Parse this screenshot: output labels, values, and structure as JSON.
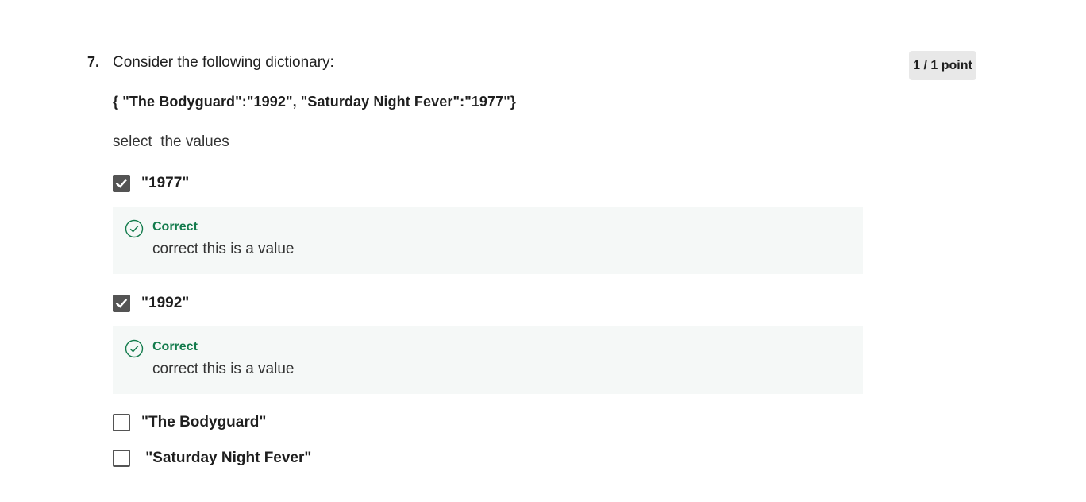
{
  "question": {
    "number": "7.",
    "prompt": "Consider the following dictionary:",
    "code": "{ \"The Bodyguard\":\"1992\", \"Saturday Night Fever\":\"1977\"}",
    "instruction": "select  the values",
    "score": "1 / 1 point"
  },
  "options": [
    {
      "label": "\"1977\"",
      "checked": true
    },
    {
      "label": "\"1992\"",
      "checked": true
    },
    {
      "label": "\"The Bodyguard\"",
      "checked": false
    },
    {
      "label": " \"Saturday Night Fever\"",
      "checked": false
    }
  ],
  "feedback": [
    {
      "title": "Correct",
      "text": "correct this is a value"
    },
    {
      "title": "Correct",
      "text": "correct this is a value"
    }
  ],
  "colors": {
    "correct_green": "#137b4c",
    "checkbox_gray": "#545454",
    "feedback_bg": "#f5f8f7",
    "badge_bg": "#e8e8e8"
  },
  "icons": {
    "checkmark": "checkmark-icon",
    "correct": "check-circle-icon"
  }
}
